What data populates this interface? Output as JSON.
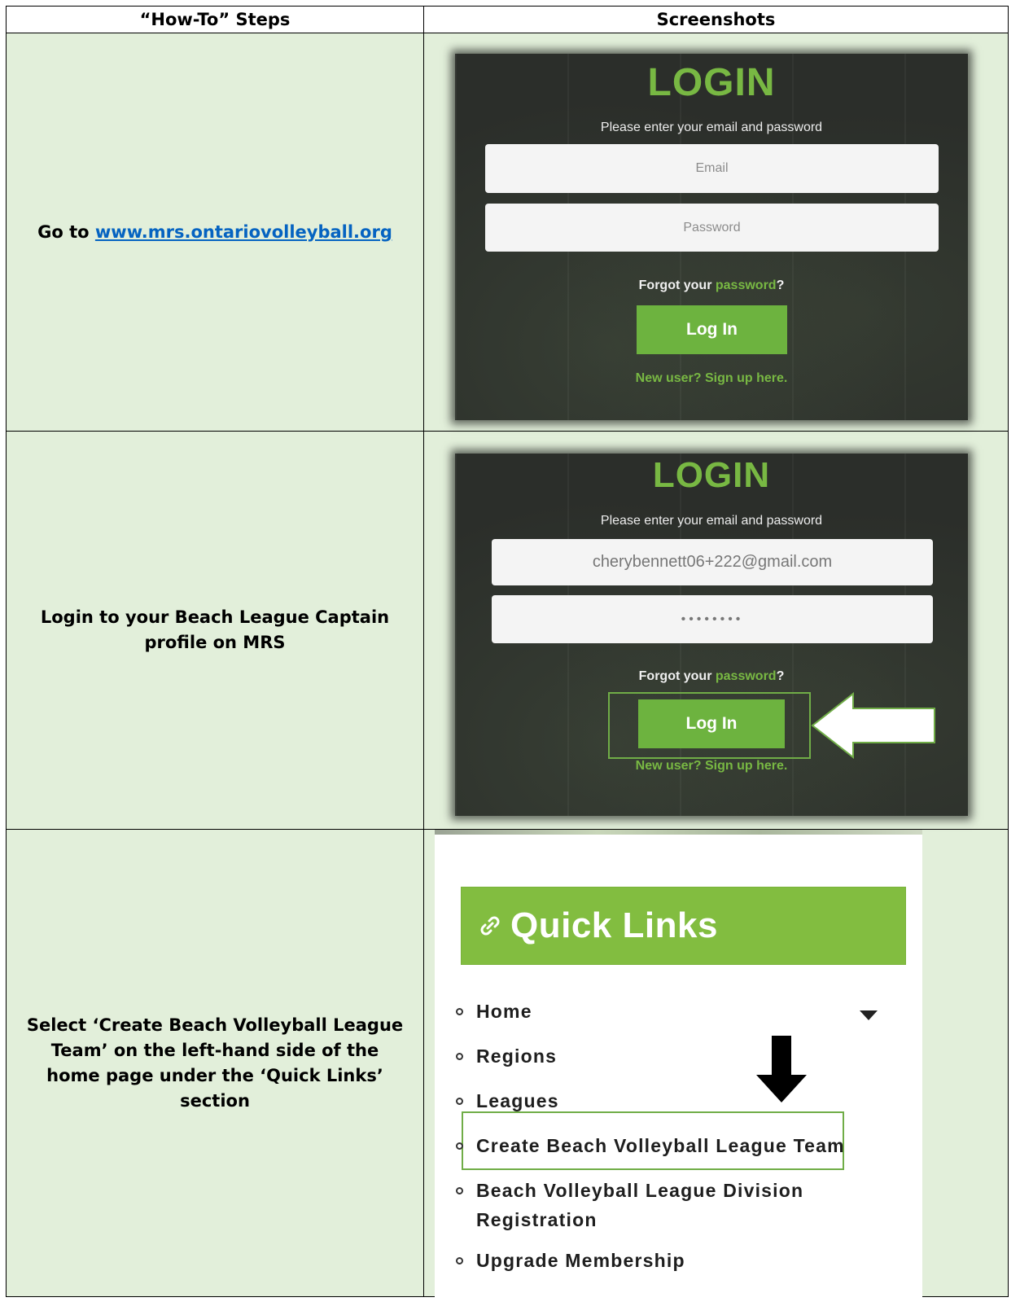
{
  "table": {
    "headers": {
      "steps": "“How-To” Steps",
      "screenshots": "Screenshots"
    },
    "rows": [
      {
        "step_prefix": "Go to ",
        "step_link": "www.mrs.ontariovolleyball.org"
      },
      {
        "step": "Login to your Beach League Captain profile on MRS"
      },
      {
        "step": "Select ‘Create Beach Volleyball League Team’ on the left-hand side of the home page under the ‘Quick Links’ section"
      }
    ]
  },
  "login1": {
    "title": "LOGIN",
    "subtitle": "Please enter your email and password",
    "email_placeholder": "Email",
    "password_placeholder": "Password",
    "forgot_prefix": "Forgot your ",
    "forgot_link": "password",
    "forgot_suffix": "?",
    "button": "Log In",
    "signup": "New user? Sign up here."
  },
  "login2": {
    "title": "LOGIN",
    "subtitle": "Please enter your email and password",
    "email_value": "cherybennett06+222@gmail.com",
    "password_value": "••••••••",
    "forgot_prefix": "Forgot your ",
    "forgot_link": "password",
    "forgot_suffix": "?",
    "button": "Log In",
    "signup": "New user? Sign up here."
  },
  "quick_links": {
    "title": "Quick Links",
    "items": [
      "Home",
      "Regions",
      "Leagues",
      "Create Beach Volleyball League Team",
      "Beach Volleyball League Division Registration",
      "Upgrade Membership"
    ]
  },
  "colors": {
    "row_background": "#e2efda",
    "accent_green": "#82bd40",
    "link_blue": "#0563c1"
  }
}
